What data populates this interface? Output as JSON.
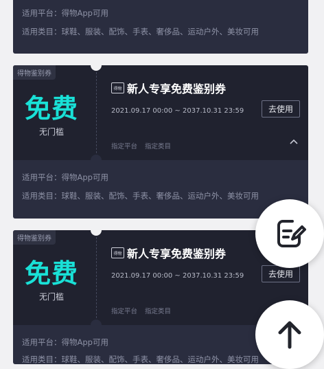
{
  "top_card": {
    "platform_line": "适用平台：得物App可用",
    "category_line": "适用类目：球鞋、服装、配饰、手表、奢侈品、运动户外、美妆可用"
  },
  "coupons": [
    {
      "tag": "得物鉴别券",
      "value": "免费",
      "threshold": "无门槛",
      "logo": "得物",
      "title": "新人专享免费鉴别券",
      "validity": "2021.09.17 00:00 ~ 2037.10.31 23:59",
      "action": "去使用",
      "scope_platform": "指定平台",
      "scope_category": "指定类目",
      "detail_platform": "适用平台：得物App可用",
      "detail_category": "适用类目：球鞋、服装、配饰、手表、奢侈品、运动户外、美妆可用"
    },
    {
      "tag": "得物鉴别券",
      "value": "免费",
      "threshold": "无门槛",
      "logo": "得物",
      "title": "新人专享免费鉴别券",
      "validity": "2021.09.17 00:00 ~ 2037.10.31 23:59",
      "action": "去使用",
      "scope_platform": "指定平台",
      "scope_category": "指定类目",
      "detail_platform": "适用平台：得物App可用",
      "detail_category": "适用类目：球鞋、服装、配饰、手表、奢侈品、运动户外、美妆可用"
    }
  ],
  "icons": {
    "edit": "edit-note-icon",
    "top": "arrow-up-icon",
    "collapse": "chevron-up-icon"
  },
  "colors": {
    "accent": "#19e1d7",
    "card": "#20222f",
    "card_detail": "#2a2d3f",
    "background": "#f1f1f3"
  }
}
